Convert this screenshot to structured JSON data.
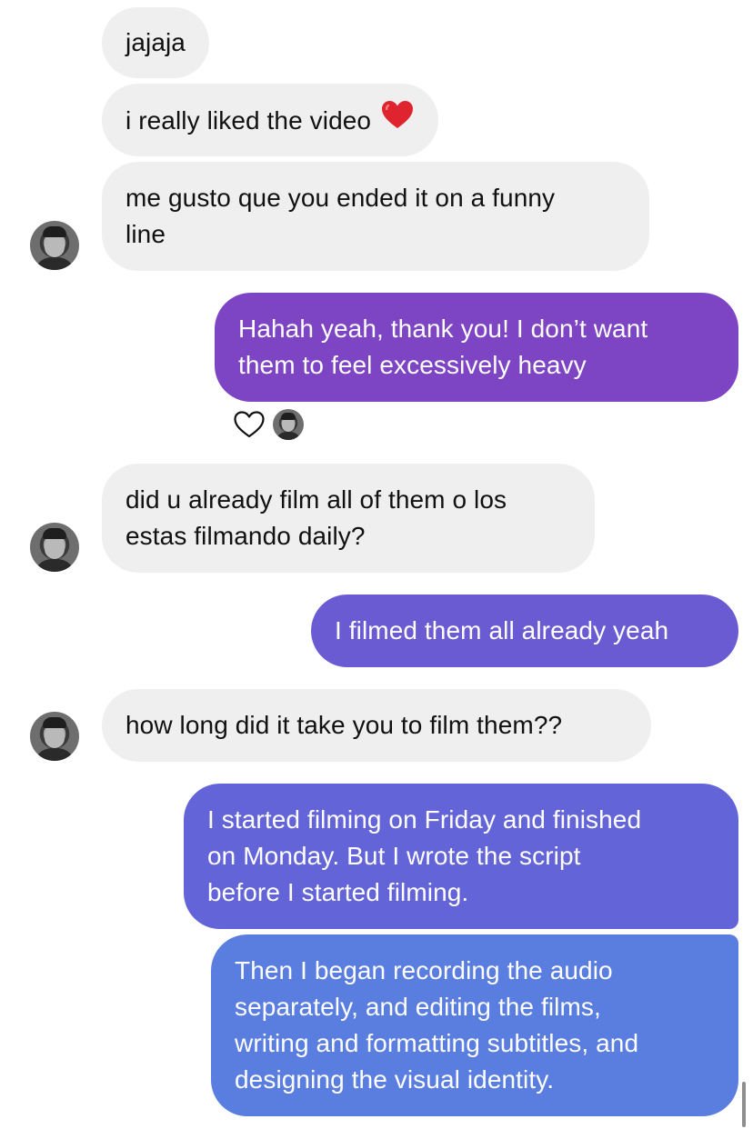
{
  "messages": [
    {
      "side": "in",
      "text": "jajaja"
    },
    {
      "side": "in",
      "text": "i really liked the video",
      "emoji": "heart-emoji"
    },
    {
      "side": "in",
      "lines": [
        "me gusto que you ended it on a funny",
        "line"
      ]
    },
    {
      "side": "out",
      "lines": [
        "Hahah yeah, thank you! I don’t want",
        "them to feel excessively heavy"
      ],
      "reaction": "heart-icon"
    },
    {
      "side": "in",
      "lines": [
        "did u already film all of them o los",
        "estas filmando daily?"
      ]
    },
    {
      "side": "out",
      "text": "I filmed them all already yeah"
    },
    {
      "side": "in",
      "text": "how long did it take you to film them??"
    },
    {
      "side": "out",
      "lines": [
        "I started filming on Friday and finished",
        "on Monday. But I wrote the script",
        "before I started filming."
      ]
    },
    {
      "side": "out",
      "lines": [
        "Then I began recording the audio",
        "separately, and editing the films,",
        "writing and formatting subtitles, and",
        "designing the visual identity."
      ]
    }
  ],
  "colors": {
    "incoming_bubble": "#efefef",
    "outgoing_1": "#7d44c4",
    "outgoing_2": "#6b5bd2",
    "outgoing_3": "#6364d8",
    "outgoing_4": "#5a7de0",
    "heart_emoji": "#e0242f"
  }
}
